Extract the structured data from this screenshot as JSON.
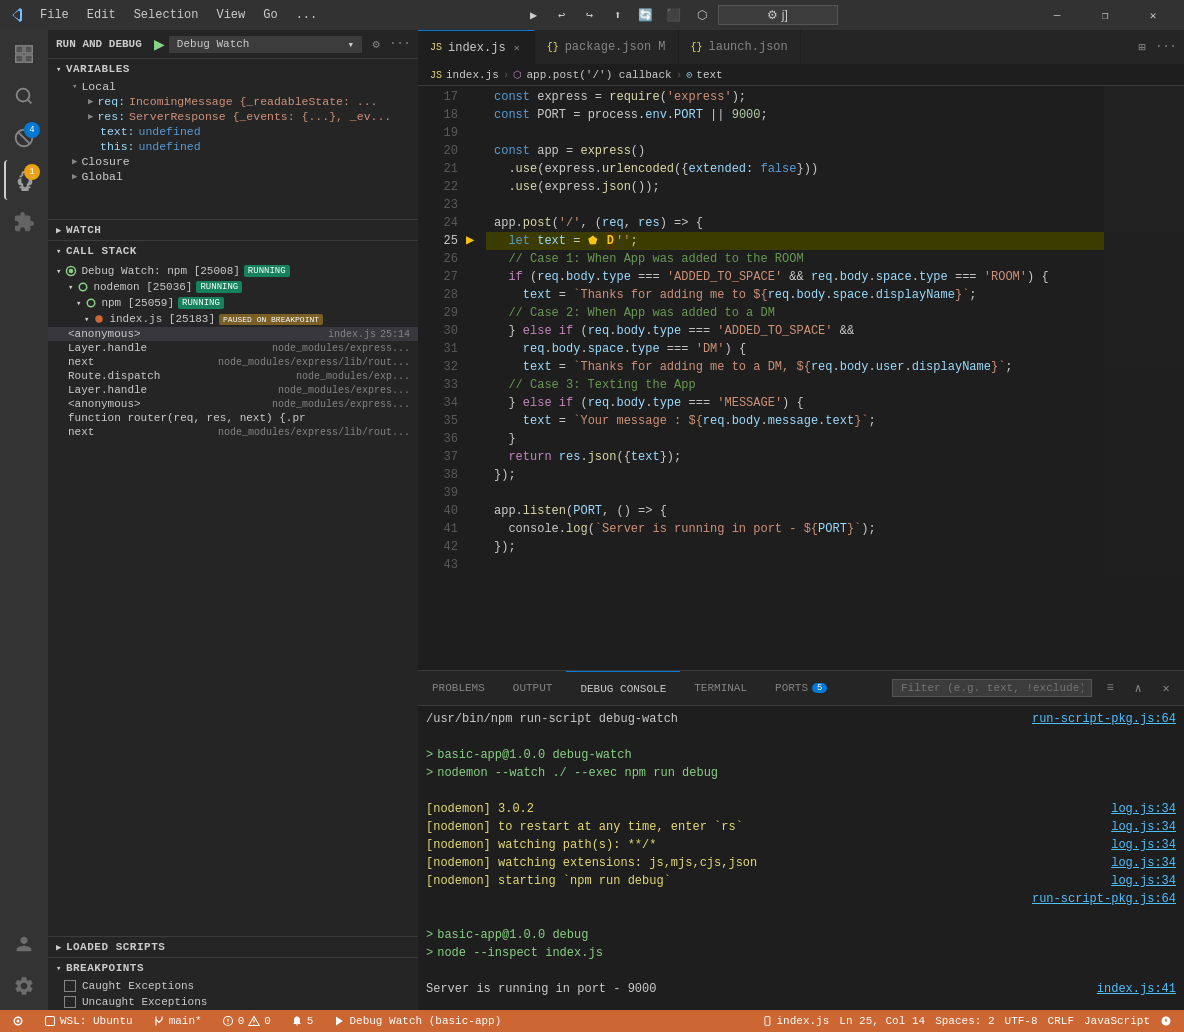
{
  "titlebar": {
    "menus": [
      "File",
      "Edit",
      "Selection",
      "View",
      "Go",
      "..."
    ],
    "win_controls": [
      "—",
      "❐",
      "✕"
    ]
  },
  "debug_toolbar": {
    "buttons": [
      "▶",
      "↩",
      "↪",
      "⬇",
      "⬆",
      "🔄",
      "⏹",
      "⬡"
    ]
  },
  "sidebar": {
    "run_debug_label": "RUN AND DEBUG",
    "config_label": "Debug Watch",
    "sections": {
      "variables_label": "VARIABLES",
      "local_label": "Local",
      "watch_label": "WATCH",
      "callstack_label": "CALL STACK",
      "loaded_scripts_label": "LOADED SCRIPTS",
      "breakpoints_label": "BREAKPOINTS"
    },
    "variables": {
      "req": "IncomingMessage {_readableState: ...",
      "res": "ServerResponse {_events: {...}, _ev...",
      "text": "undefined",
      "this": "undefined"
    },
    "callstack": [
      {
        "name": "Debug Watch: npm [25008]",
        "status": "RUNNING",
        "children": [
          {
            "name": "nodemon [25036]",
            "status": "RUNNING"
          },
          {
            "name": "npm [25059]",
            "status": "RUNNING",
            "children": [
              {
                "name": "index.js [25183]",
                "status": "PAUSED ON BREAKPOINT",
                "frames": [
                  {
                    "name": "<anonymous>",
                    "file": "index.js",
                    "line": "25:14"
                  },
                  {
                    "name": "Layer.handle",
                    "file": "node_modules/express...",
                    "line": ""
                  },
                  {
                    "name": "next",
                    "file": "node_modules/express/lib/rout...",
                    "line": ""
                  },
                  {
                    "name": "Route.dispatch",
                    "file": "node_modules/exp...",
                    "line": ""
                  },
                  {
                    "name": "Layer.handle",
                    "file": "node_modules/expres...",
                    "line": ""
                  },
                  {
                    "name": "<anonymous>",
                    "file": "node_modules/express...",
                    "line": ""
                  },
                  {
                    "name": "function router(req, res, next) {.pr",
                    "file": "",
                    "line": ""
                  },
                  {
                    "name": "next",
                    "file": "node_modules/express/lib/rout...",
                    "line": ""
                  }
                ]
              }
            ]
          }
        ]
      }
    ],
    "breakpoints": [
      {
        "label": "Caught Exceptions",
        "checked": false
      },
      {
        "label": "Uncaught Exceptions",
        "checked": false
      }
    ]
  },
  "tabs": [
    {
      "label": "index.js",
      "active": true,
      "type": "js",
      "modified": false
    },
    {
      "label": "package.json M",
      "active": false,
      "type": "json",
      "modified": true
    },
    {
      "label": "launch.json",
      "active": false,
      "type": "json",
      "modified": false
    }
  ],
  "breadcrumb": {
    "items": [
      "index.js",
      "app.post('/') callback",
      "text"
    ]
  },
  "code": {
    "lines": [
      {
        "num": 17,
        "content": "const express = require('express');"
      },
      {
        "num": 18,
        "content": "const PORT = process.env.PORT || 9000;"
      },
      {
        "num": 19,
        "content": ""
      },
      {
        "num": 20,
        "content": "const app = express()"
      },
      {
        "num": 21,
        "content": "  .use(express.urlencoded({extended: false}))"
      },
      {
        "num": 22,
        "content": "  .use(express.json());"
      },
      {
        "num": 23,
        "content": ""
      },
      {
        "num": 24,
        "content": "app.post('/', (req, res) => {"
      },
      {
        "num": 25,
        "content": "  let text = ● D'';",
        "highlighted": true,
        "debug": true
      },
      {
        "num": 26,
        "content": "  // Case 1: When App was added to the ROOM"
      },
      {
        "num": 27,
        "content": "  if (req.body.type === 'ADDED_TO_SPACE' && req.body.space.type === 'ROOM') {"
      },
      {
        "num": 28,
        "content": "    text = `Thanks for adding me to ${req.body.space.displayName}`;"
      },
      {
        "num": 29,
        "content": "  // Case 2: When App was added to a DM"
      },
      {
        "num": 30,
        "content": "  } else if (req.body.type === 'ADDED_TO_SPACE' &&"
      },
      {
        "num": 31,
        "content": "    req.body.space.type === 'DM') {"
      },
      {
        "num": 32,
        "content": "    text = `Thanks for adding me to a DM, ${req.body.user.displayName}`;"
      },
      {
        "num": 33,
        "content": "  // Case 3: Texting the App"
      },
      {
        "num": 34,
        "content": "  } else if (req.body.type === 'MESSAGE') {"
      },
      {
        "num": 35,
        "content": "    text = `Your message : ${req.body.message.text}`;"
      },
      {
        "num": 36,
        "content": "  }"
      },
      {
        "num": 37,
        "content": "  return res.json({text});"
      },
      {
        "num": 38,
        "content": "});"
      },
      {
        "num": 39,
        "content": ""
      },
      {
        "num": 40,
        "content": "app.listen(PORT, () => {"
      },
      {
        "num": 41,
        "content": "  console.log(`Server is running in port - ${PORT}`);"
      },
      {
        "num": 42,
        "content": "});"
      },
      {
        "num": 43,
        "content": ""
      }
    ]
  },
  "panel": {
    "tabs": [
      "PROBLEMS",
      "OUTPUT",
      "DEBUG CONSOLE",
      "TERMINAL",
      "PORTS"
    ],
    "ports_count": "5",
    "active_tab": "DEBUG CONSOLE",
    "filter_placeholder": "Filter (e.g. text, !exclude)",
    "console_output": [
      {
        "text": "/usr/bin/npm run-script debug-watch",
        "link": "run-script-pkg.js:64",
        "color": "white"
      },
      {
        "text": "",
        "link": "",
        "color": "white"
      },
      {
        "prompt": ">",
        "text": " basic-app@1.0.0 debug-watch",
        "link": "",
        "color": "green"
      },
      {
        "prompt": ">",
        "text": " nodemon --watch ./ --exec npm run debug",
        "link": "",
        "color": "green"
      },
      {
        "text": "",
        "link": "",
        "color": "white"
      },
      {
        "text": "[nodemon] 3.0.2",
        "link": "log.js:34",
        "color": "yellow"
      },
      {
        "text": "[nodemon] to restart at any time, enter `rs`",
        "link": "log.js:34",
        "color": "yellow"
      },
      {
        "text": "[nodemon] watching path(s): **/*",
        "link": "log.js:34",
        "color": "yellow"
      },
      {
        "text": "[nodemon] watching extensions: js,mjs,cjs,json",
        "link": "log.js:34",
        "color": "yellow"
      },
      {
        "text": "[nodemon] starting `npm run debug`",
        "link": "log.js:34",
        "color": "yellow"
      },
      {
        "text": "",
        "link": "run-script-pkg.js:64",
        "color": "white"
      },
      {
        "text": "",
        "link": "",
        "color": "white"
      },
      {
        "prompt": ">",
        "text": " basic-app@1.0.0 debug",
        "link": "",
        "color": "green"
      },
      {
        "prompt": ">",
        "text": " node --inspect index.js",
        "link": "",
        "color": "green"
      },
      {
        "text": "",
        "link": "",
        "color": "white"
      },
      {
        "text": "Server is running in port - 9000",
        "link": "index.js:41",
        "color": "white"
      }
    ]
  },
  "statusbar": {
    "debug_label": "Debug Watch (basic-app)",
    "wsl": "WSL: Ubuntu",
    "branch": "main*",
    "errors": "0",
    "warnings": "0",
    "alerts": "5",
    "position": "Ln 25, Col 14",
    "spaces": "Spaces: 2",
    "encoding": "UTF-8",
    "line_ending": "CRLF",
    "language": "JavaScript",
    "file_status": "index.js"
  }
}
